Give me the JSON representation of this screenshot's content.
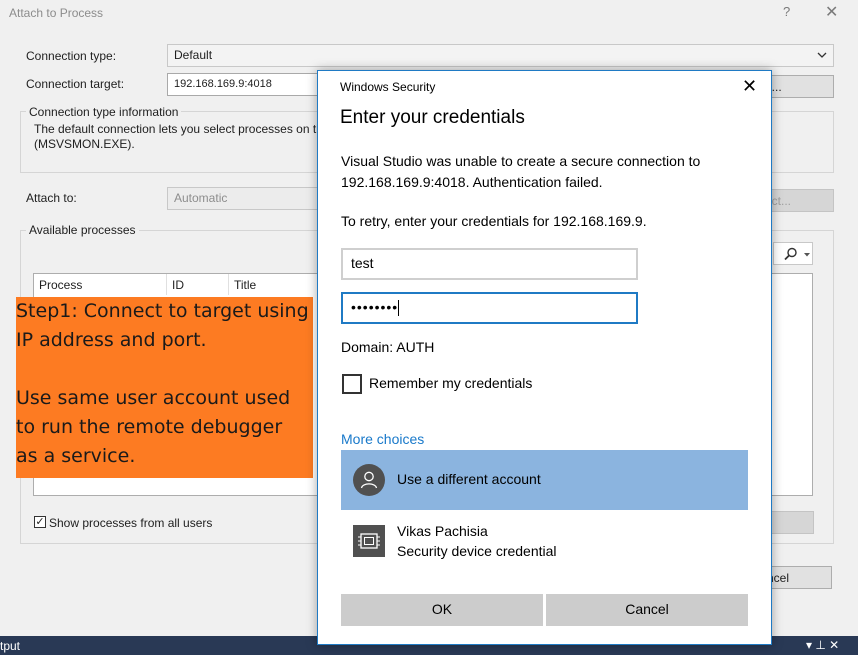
{
  "attach_dialog": {
    "title": "Attach to Process",
    "help_glyph": "?",
    "close_glyph": "✕",
    "connection_type_label": "Connection type:",
    "connection_type_value": "Default",
    "connection_target_label": "Connection target:",
    "connection_target_value": "192.168.169.9:4018",
    "find_button_label": "d...",
    "info_group_title": "Connection type information",
    "info_text_line1": "The default connection lets you select processes on th",
    "info_text_line2": "(MSVSMON.EXE).",
    "attach_to_label": "Attach to:",
    "attach_to_value": "Automatic",
    "select_button_label": "ect...",
    "available_processes_title": "Available processes",
    "columns": [
      "Process",
      "ID",
      "Title"
    ],
    "show_all_users_label": "Show processes from all users",
    "show_all_users_checked": "✓",
    "cancel_button_label": "ncel"
  },
  "status_bar": {
    "left_text": "tput",
    "right_icons": "▾ ⊥ ✕"
  },
  "note": {
    "line1": "Step1: Connect to target using",
    "line2": "IP address and port.",
    "line3": "",
    "line4": "Use same user account used",
    "line5": "to run the remote debugger",
    "line6": "as a service.",
    "background_color": "#fd7b22"
  },
  "windows_security": {
    "title": "Windows Security",
    "close_glyph": "✕",
    "heading": "Enter your credentials",
    "message_line1": "Visual Studio was unable to create a secure connection to",
    "message_line2": "192.168.169.9:4018. Authentication failed.",
    "retry_text": "To retry, enter your credentials for 192.168.169.9.",
    "username_value": "test",
    "password_value": "••••••••",
    "domain_text": "Domain: AUTH",
    "remember_label": "Remember my credentials",
    "more_choices_label": "More choices",
    "accounts": [
      {
        "name": "Use a different account",
        "icon": "user-avatar-icon"
      },
      {
        "name": "Vikas Pachisia",
        "subtitle": "Security device credential",
        "icon": "security-chip-icon"
      }
    ],
    "ok_label": "OK",
    "cancel_label": "Cancel",
    "accent_color": "#1979ca"
  }
}
